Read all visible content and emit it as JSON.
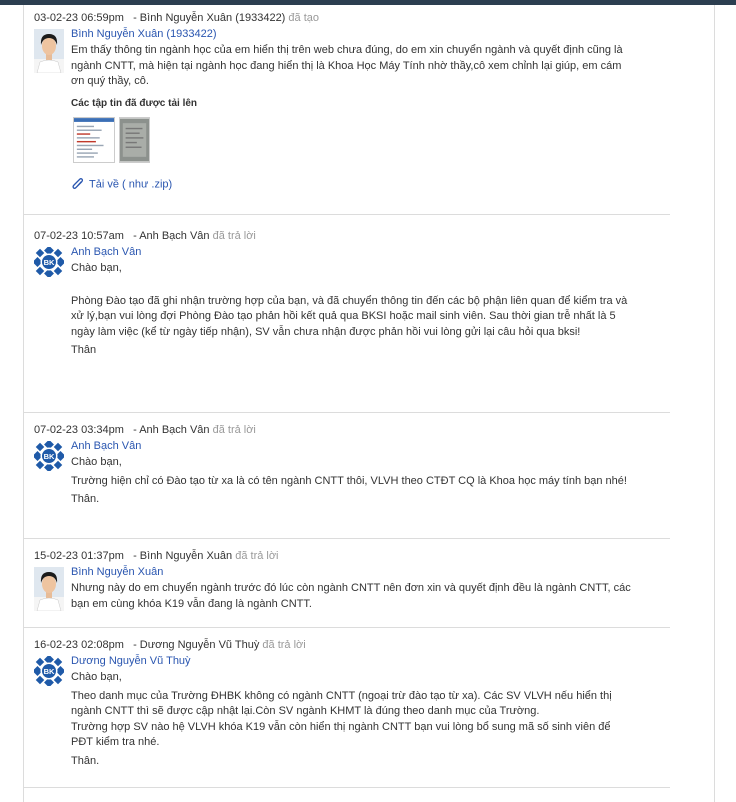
{
  "entries": [
    {
      "date": "03-02-23 06:59pm",
      "sender": "- Bình Nguyễn Xuân (1933422)",
      "status": "đã tạo",
      "author": "Bình Nguyễn Xuân (1933422)",
      "avatar": "student-photo",
      "paragraphs": [
        "Em thấy thông tin ngành học của em hiển thị trên web chưa đúng, do em xin chuyển ngành và quyết định cũng là ngành CNTT, mà hiện tại ngành học đang hiển thị là Khoa Học Máy Tính nhờ thầy,cô xem chỉnh lại giúp, em cám ơn quý thầy, cô."
      ],
      "files_title": "Các tập tin đã được tải lên",
      "download": "Tải về ( như .zip)"
    },
    {
      "date": "07-02-23 10:57am",
      "sender": "- Anh Bạch Vân",
      "status": "đã trả lời",
      "author": "Anh Bạch Vân",
      "avatar": "bk-logo",
      "paragraphs": [
        "Chào bạn,",
        "Phòng Đào tạo đã ghi nhận trường hợp của bạn, và đã chuyển thông tin đến các bộ phận liên quan để kiểm tra và xử lý,bạn vui lòng đợi Phòng Đào tạo phản hồi kết quả qua BKSI hoặc mail sinh viên. Sau thời gian trễ nhất là 5 ngày làm việc (kể từ ngày tiếp nhận), SV vẫn chưa nhận được phản hồi vui lòng gửi lại câu hỏi qua bksi!",
        "Thân"
      ]
    },
    {
      "date": "07-02-23 03:34pm",
      "sender": "- Anh Bạch Vân",
      "status": "đã trả lời",
      "author": "Anh Bạch Vân",
      "avatar": "bk-logo",
      "paragraphs": [
        "Chào bạn,",
        "Trường hiện chỉ có Đào tạo từ xa là có tên ngành CNTT thôi, VLVH theo CTĐT CQ là Khoa học máy tính bạn nhé!",
        "Thân."
      ]
    },
    {
      "date": "15-02-23 01:37pm",
      "sender": "- Bình Nguyễn Xuân",
      "status": "đã trả lời",
      "author": "Bình Nguyễn Xuân",
      "avatar": "student-photo",
      "paragraphs": [
        "Nhưng này do em chuyển ngành trước đó lúc còn ngành CNTT nên đơn xin và quyết định đều là ngành CNTT, các bạn em cùng khóa K19 vẫn đang là ngành CNTT."
      ]
    },
    {
      "date": "16-02-23 02:08pm",
      "sender": "- Dương Nguyễn Vũ Thuỳ",
      "status": "đã trả lời",
      "author": "Dương Nguyễn Vũ Thuỳ",
      "avatar": "bk-logo",
      "paragraphs": [
        "Chào bạn,",
        "Theo danh mục của Trường ĐHBK không có ngành CNTT (ngoại trừ đào tạo từ xa). Các SV VLVH nếu hiển thị ngành CNTT thì sẽ được cập nhật lại.Còn SV ngành KHMT là đúng theo danh mục của Trường.",
        "Trường hợp SV nào hệ VLVH khóa K19 vẫn còn hiển thị ngành CNTT bạn vui lòng bổ sung mã số sinh viên để PĐT kiểm tra nhé.",
        "Thân."
      ]
    }
  ],
  "colors": {
    "link": "#2a56b0",
    "status": "#999999",
    "bk_logo": "#1f5aa8",
    "topbar": "#2c3e50"
  }
}
